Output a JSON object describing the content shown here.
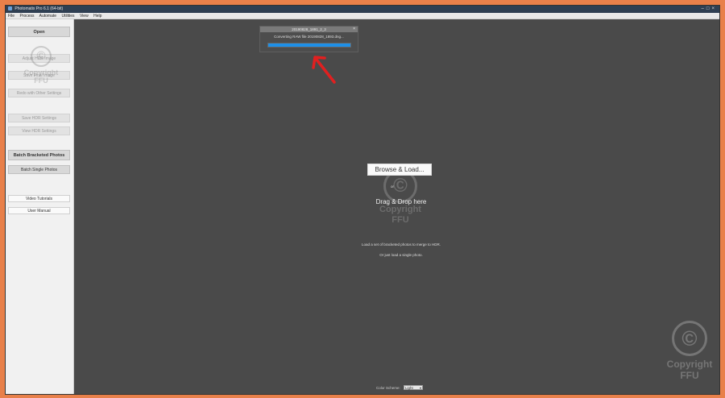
{
  "window": {
    "title": "Photomatix Pro 6.1 (64-bit)",
    "controls": "–□×"
  },
  "menu": [
    "File",
    "Process",
    "Automate",
    "Utilities",
    "View",
    "Help"
  ],
  "sidebar": {
    "open": "Open",
    "adjust_hdr": "Adjust HDR Image",
    "save_final": "Save Final Image",
    "redo_other": "Redo with Other Settings",
    "save_hdr_settings": "Save HDR Settings",
    "view_hdr_settings": "View HDR Settings",
    "batch_bracketed": "Batch Bracketed Photos",
    "batch_single": "Batch Single Photos",
    "video_tutorials": "Video Tutorials",
    "user_manual": "User Manual"
  },
  "dialog": {
    "title": "20190828_1891_2_3",
    "close": "×",
    "message": "Converting RAW file 20190828_1893.dng...",
    "progress": 1.0
  },
  "main": {
    "browse_label": "Browse & Load...",
    "or_label": "or",
    "drag_label": "Drag & Drop here",
    "hint1": "Load a set of bracketed photos to merge to HDR.",
    "hint2": "Or just load a single photo."
  },
  "color_scheme": {
    "label": "Color Scheme:",
    "value": "Light"
  },
  "watermark": {
    "symbol": "©",
    "line1": "Copyright",
    "line2": "FFU"
  },
  "colors": {
    "progress_fill": "#1e90e8",
    "annotation_arrow": "#e02020",
    "frame": "#e8804a"
  }
}
